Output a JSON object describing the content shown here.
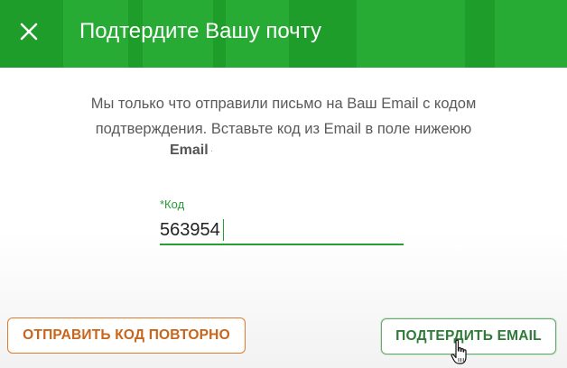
{
  "header": {
    "title": "Подтердите Вашу почту",
    "close_icon": "close-icon",
    "background_color": "#1e9d2b"
  },
  "body": {
    "message": "Мы только что отправили письмо на Ваш Email с кодом подтверждения. Вставьте код из Email в поле нижеюю",
    "email_label": "Email",
    "email_value": "·"
  },
  "code_field": {
    "label": "*Код",
    "value": "563954",
    "accent_color": "#26a033"
  },
  "actions": {
    "resend_label": "ОТПРАВИТЬ КОД ПОВТОРНО",
    "confirm_label": "ПОДТЕРДИТЬ EMAIL",
    "resend_color": "#e07a2e",
    "confirm_color": "#2f7a39"
  }
}
